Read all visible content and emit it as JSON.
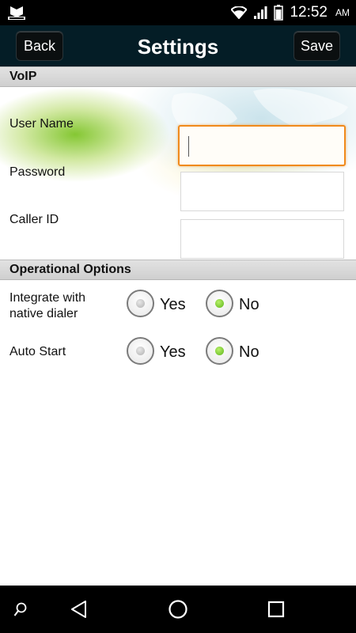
{
  "status_bar": {
    "time": "12:52",
    "ampm": "AM",
    "icons": [
      "carrier-logo-icon",
      "wifi-icon",
      "signal-icon",
      "battery-icon"
    ]
  },
  "title_bar": {
    "title": "Settings",
    "back_label": "Back",
    "save_label": "Save"
  },
  "voip": {
    "header": "VoIP",
    "fields": [
      {
        "label": "User Name",
        "value": "",
        "focused": true
      },
      {
        "label": "Password",
        "value": ""
      },
      {
        "label": "Caller ID",
        "value": ""
      }
    ]
  },
  "options": {
    "header": "Operational Options",
    "rows": [
      {
        "label_line1": "Integrate with",
        "label_line2": "native dialer",
        "yes": "Yes",
        "no": "No",
        "selected": "No"
      },
      {
        "label_line1": "Auto Start",
        "label_line2": "",
        "yes": "Yes",
        "no": "No",
        "selected": "No"
      }
    ]
  },
  "nav_bar": {
    "icons": [
      "search-icon",
      "back-icon",
      "home-icon",
      "recents-icon"
    ]
  },
  "colors": {
    "titlebar": "#041d26",
    "focus_border": "#f08a1c",
    "radio_selected": "#5db51a"
  }
}
